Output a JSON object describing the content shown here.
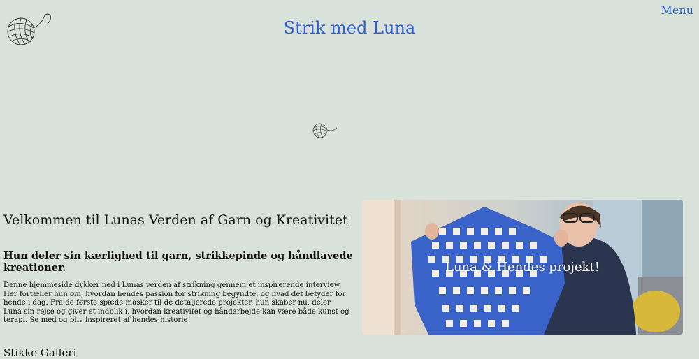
{
  "header": {
    "logo_icon": "yarn-ball-icon",
    "title": "Strik med Luna",
    "menu_label": "Menu"
  },
  "hero_divider": {
    "icon": "yarn-ball-icon"
  },
  "content": {
    "welcome_title": "Velkommen til Lunas Verden af Garn og Kreativitet",
    "subtitle": "Hun deler sin kærlighed til garn, strikkepinde og håndlavede kreationer.",
    "intro": "Denne hjemmeside dykker ned i Lunas verden af strikning gennem et inspirerende interview. Her fortæller hun om, hvordan hendes passion for strikning begyndte, og hvad det betyder for hende i dag. Fra de første spæde masker til de detaljerede projekter, hun skaber nu, deler Luna sin rejse og giver et indblik i, hvordan kreativitet og håndarbejde kan være både kunst og terapi. Se med og bliv inspireret af hendes historie!",
    "gallery_title": "Stikke Galleri"
  },
  "hero_image": {
    "caption": "Luna & Hendes projekt!"
  },
  "colors": {
    "background": "#d8e1da",
    "accent": "#2f5fd3"
  }
}
